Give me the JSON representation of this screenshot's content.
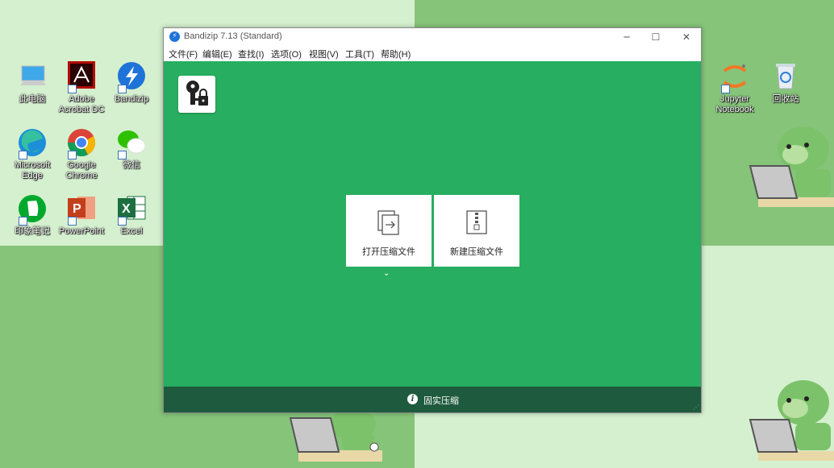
{
  "window": {
    "title": "Bandizip 7.13 (Standard)",
    "controls": {
      "minimize": "─",
      "maximize": "☐",
      "close": "✕"
    },
    "menu": [
      "文件(F)",
      "编辑(E)",
      "查找(I)",
      "选项(O)",
      "视图(V)",
      "工具(T)",
      "帮助(H)"
    ],
    "actions": {
      "open_archive": "打开压缩文件",
      "new_archive": "新建压缩文件"
    },
    "chevron": "⌄",
    "status": {
      "icon": "i",
      "text": "固实压缩"
    },
    "grip": "⋰"
  },
  "desktop": {
    "icons": [
      {
        "label": "此电脑",
        "icon": "computer-icon"
      },
      {
        "label": "Adobe\nAcrobat DC",
        "icon": "acrobat-icon"
      },
      {
        "label": "Bandizip",
        "icon": "bandizip-icon"
      },
      {
        "label": "Microsoft\nEdge",
        "icon": "edge-icon"
      },
      {
        "label": "Google\nChrome",
        "icon": "chrome-icon"
      },
      {
        "label": "微信",
        "icon": "wechat-icon"
      },
      {
        "label": "印象笔记",
        "icon": "evernote-icon"
      },
      {
        "label": "PowerPoint",
        "icon": "powerpoint-icon"
      },
      {
        "label": "Excel",
        "icon": "excel-icon"
      },
      {
        "label": "Jupyter\nNotebook",
        "icon": "jupyter-icon"
      },
      {
        "label": "回收站",
        "icon": "recycle-bin-icon"
      }
    ]
  },
  "colors": {
    "main_bg": "#27ae60",
    "status_bg": "#1e5a3d",
    "desktop_light": "#d5f0cf",
    "desktop_dark": "#86c47a"
  }
}
